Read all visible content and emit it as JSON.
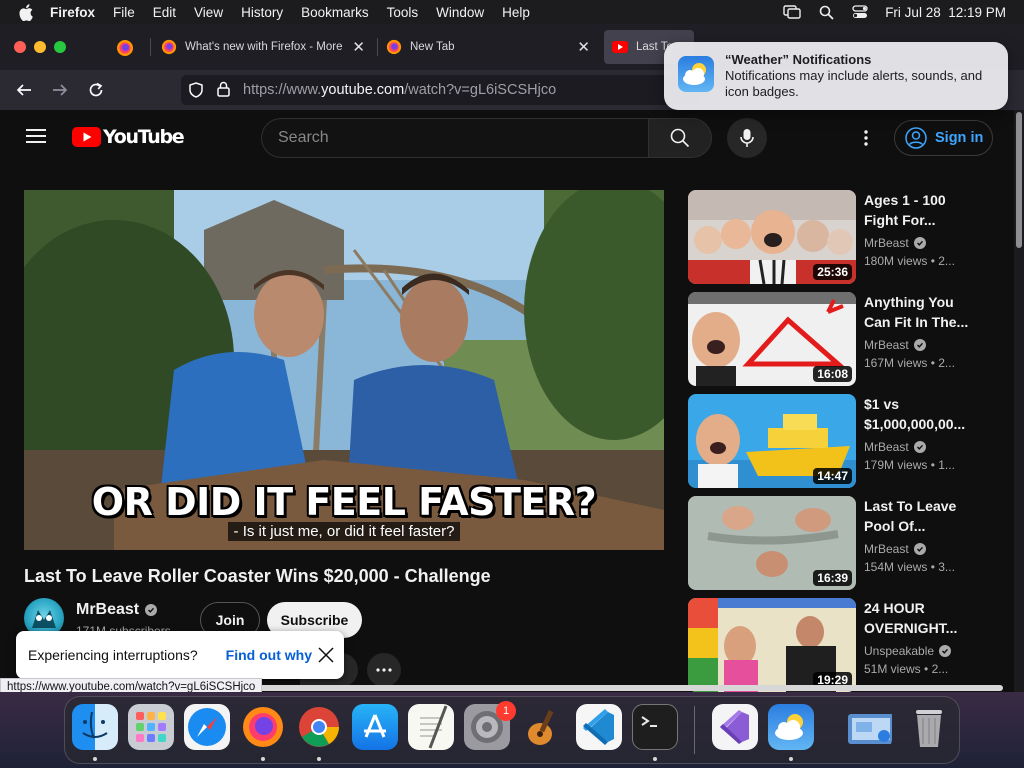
{
  "menubar": {
    "app_name": "Firefox",
    "menus": [
      "File",
      "Edit",
      "View",
      "History",
      "Bookmarks",
      "Tools",
      "Window",
      "Help"
    ],
    "datetime": "Fri Jul 28  12:19 PM"
  },
  "browser": {
    "tabs": [
      {
        "title": "What's new with Firefox - More",
        "close": "✕"
      },
      {
        "title": "New Tab",
        "close": "✕"
      },
      {
        "title": "Last To"
      }
    ],
    "url": {
      "prefix": "https://www.",
      "host": "youtube.com",
      "path": "/watch?v=gL6iSCSHjco"
    },
    "status_url": "https://www.youtube.com/watch?v=gL6iSCSHjco",
    "brand_color": "#ff0000"
  },
  "notification": {
    "title": "“Weather” Notifications",
    "body": "Notifications may include alerts, sounds, and icon badges."
  },
  "youtube": {
    "logo_text": "YouTube",
    "search_placeholder": "Search",
    "sign_in": "Sign in",
    "video": {
      "caption_big": "OR DID IT FEEL FASTER?",
      "caption_sub": "- Is it just me, or did it feel faster?",
      "title": "Last To Leave Roller Coaster Wins $20,000 - Challenge",
      "channel": "MrBeast",
      "subscribers": "171M subscribers",
      "join": "Join",
      "subscribe": "Subscribe"
    },
    "toast": {
      "text": "Experiencing interruptions?",
      "link": "Find out why"
    },
    "recommendations": [
      {
        "title_1": "Ages 1 - 100",
        "title_2": "Fight For...",
        "channel": "MrBeast",
        "views": "180M views",
        "age": "• 2...",
        "duration": "25:36"
      },
      {
        "title_1": "Anything You",
        "title_2": "Can Fit In The...",
        "channel": "MrBeast",
        "views": "167M views",
        "age": "• 2...",
        "duration": "16:08"
      },
      {
        "title_1": "$1 vs",
        "title_2": "$1,000,000,00...",
        "channel": "MrBeast",
        "views": "179M views",
        "age": "• 1...",
        "duration": "14:47"
      },
      {
        "title_1": "Last To Leave",
        "title_2": "Pool Of...",
        "channel": "MrBeast",
        "views": "154M views",
        "age": "• 3...",
        "duration": "16:39"
      },
      {
        "title_1": "24 HOUR",
        "title_2": "OVERNIGHT...",
        "channel": "Unspeakable",
        "views": "51M views",
        "age": "• 2...",
        "duration": "19:29"
      }
    ]
  },
  "dock": {
    "apps": [
      "finder-icon",
      "launchpad-icon",
      "safari-icon",
      "firefox-icon",
      "chrome-icon",
      "app-store-icon",
      "textedit-icon",
      "system-settings-icon",
      "garageband-icon",
      "vscode-icon",
      "terminal-icon",
      "visual-studio-icon",
      "weather-icon",
      "downloads-folder-icon",
      "trash-icon"
    ],
    "settings_badge": "1"
  }
}
